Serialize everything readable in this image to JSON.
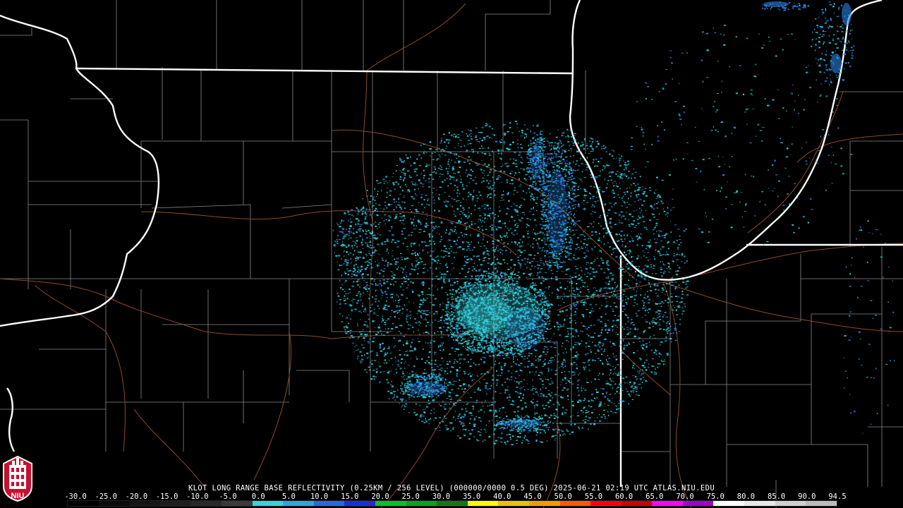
{
  "caption": "KLOT LONG RANGE BASE REFLECTIVITY (0.25KM / 256 LEVEL) (000000/0000 0.5 DEG) 2025-06-21 02:19 UTC  ATLAS.NIU.EDU",
  "colorbar": {
    "ticks": [
      "-30.0",
      "-25.0",
      "-20.0",
      "-15.0",
      "-10.0",
      "-5.0",
      "0.0",
      "5.0",
      "10.0",
      "15.0",
      "20.0",
      "25.0",
      "30.0",
      "35.0",
      "40.0",
      "45.0",
      "50.0",
      "55.0",
      "60.0",
      "65.0",
      "70.0",
      "75.0",
      "80.0",
      "85.0",
      "90.0",
      "94.5"
    ],
    "colors": [
      "#000000",
      "#0b0b0b",
      "#151515",
      "#1e1e1e",
      "#282828",
      "#3a3a3a",
      "#33d6d6",
      "#2aa6e6",
      "#1f6ce8",
      "#1a2fd9",
      "#06c61a",
      "#03a814",
      "#0a7d0a",
      "#ffff00",
      "#e8c400",
      "#ff9600",
      "#ff5a00",
      "#ff0000",
      "#c80000",
      "#ff00ff",
      "#a000d0",
      "#ffffff",
      "#e8e8e8",
      "#d0d0d0",
      "#bcbcbc"
    ]
  },
  "logo": {
    "text": "NIU",
    "color": "#c8102e"
  },
  "colors": {
    "background": "#000000",
    "state_border": "#ffffff",
    "county": "#8a8a8a",
    "highway": "#8b4a2b",
    "echo_light": "#2fd0dc",
    "echo_mid": "#2a82e8"
  }
}
